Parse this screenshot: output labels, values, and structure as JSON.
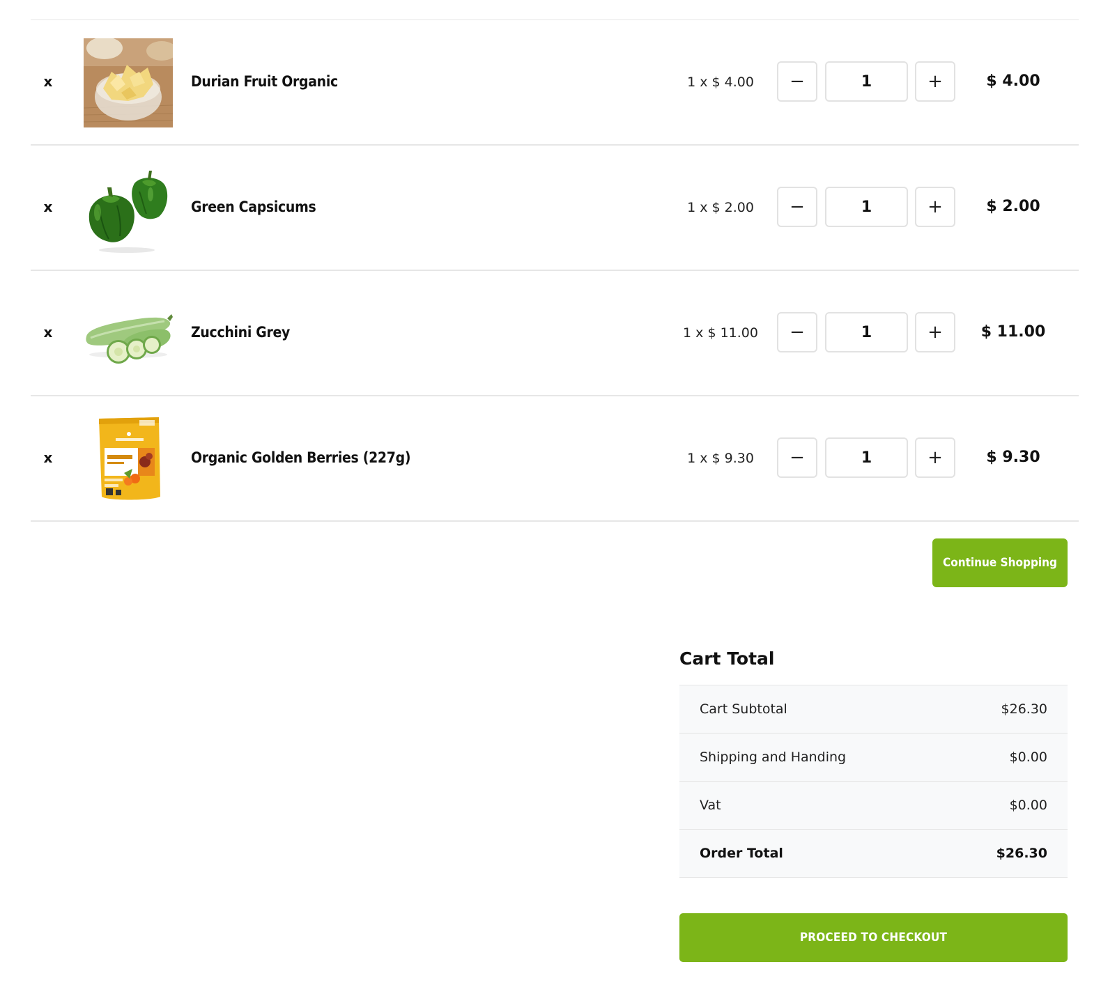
{
  "cart": {
    "remove_label": "x",
    "minus_label": "−",
    "plus_label": "+",
    "items": [
      {
        "name": "Durian Fruit Organic",
        "image": "durian-chips-bowl-image",
        "unit_price": "1 x $ 4.00",
        "quantity": "1",
        "line_total": "$ 4.00"
      },
      {
        "name": "Green Capsicums",
        "image": "green-capsicums-image",
        "unit_price": "1 x $ 2.00",
        "quantity": "1",
        "line_total": "$ 2.00"
      },
      {
        "name": "Zucchini Grey",
        "image": "zucchini-image",
        "unit_price": "1 x $ 11.00",
        "quantity": "1",
        "line_total": "$ 11.00"
      },
      {
        "name": "Organic Golden Berries (227g)",
        "image": "golden-berries-package-image",
        "unit_price": "1 x $ 9.30",
        "quantity": "1",
        "line_total": "$ 9.30"
      }
    ]
  },
  "actions": {
    "continue_label": "Continue Shopping",
    "checkout_label": "PROCEED TO CHECKOUT"
  },
  "totals": {
    "title": "Cart Total",
    "rows": [
      {
        "label": "Cart Subtotal",
        "value": "$26.30"
      },
      {
        "label": "Shipping and Handing",
        "value": "$0.00"
      },
      {
        "label": "Vat",
        "value": "$0.00"
      },
      {
        "label": "Order Total",
        "value": "$26.30"
      }
    ]
  },
  "colors": {
    "accent": "#7cb518",
    "row_border": "#e6e6e6",
    "totals_bg": "#f8f9fa"
  }
}
